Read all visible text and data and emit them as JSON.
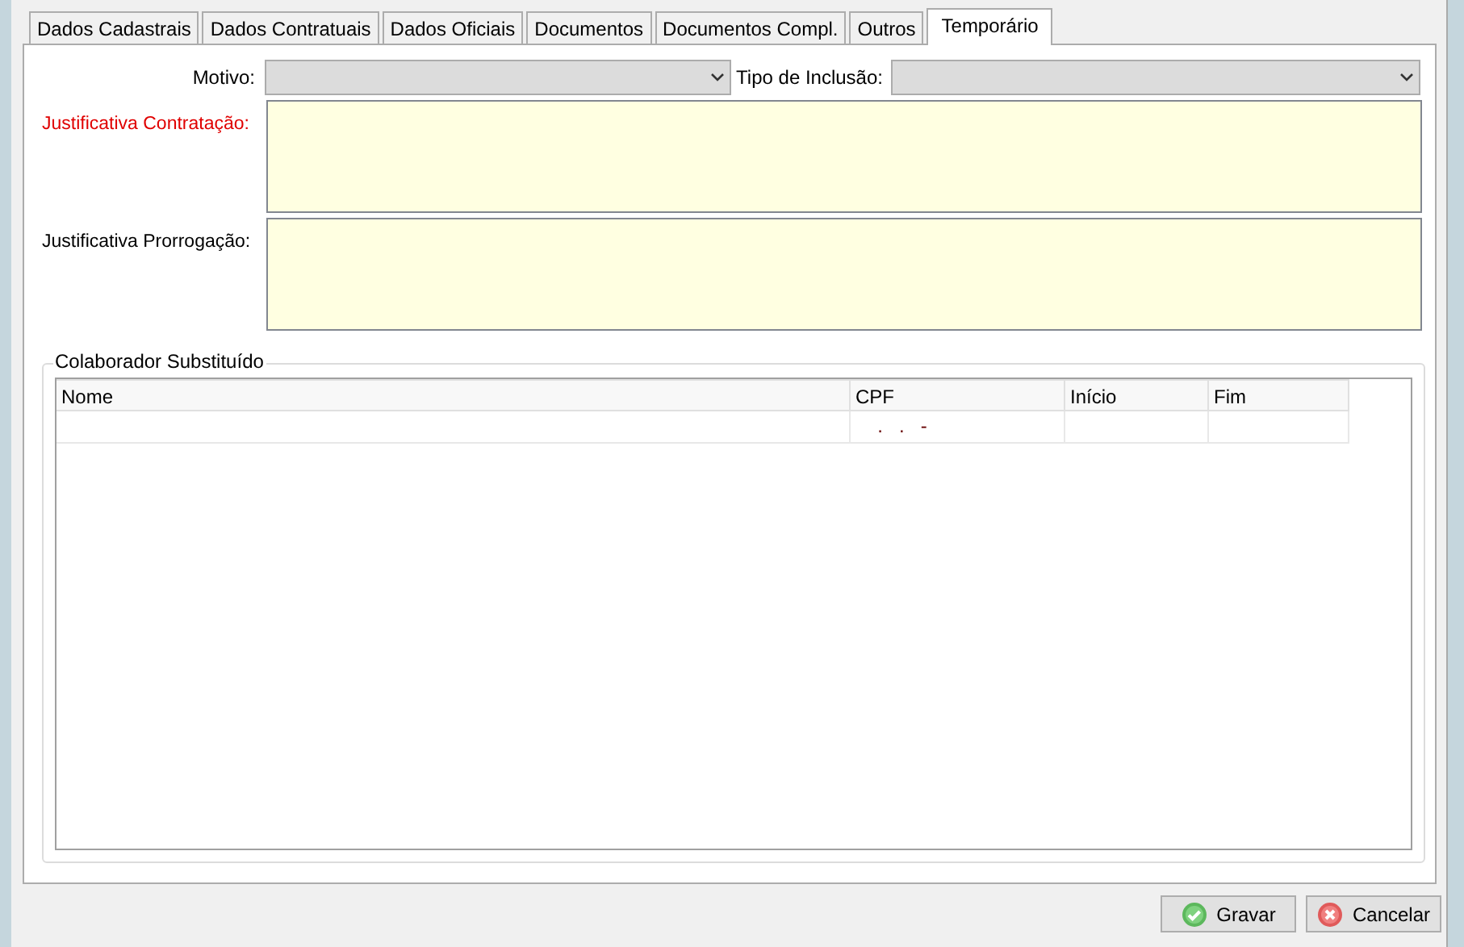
{
  "tabs": [
    {
      "label": "Dados Cadastrais",
      "selected": false
    },
    {
      "label": "Dados Contratuais",
      "selected": false
    },
    {
      "label": "Dados Oficiais",
      "selected": false
    },
    {
      "label": "Documentos",
      "selected": false
    },
    {
      "label": "Documentos Compl.",
      "selected": false
    },
    {
      "label": "Outros",
      "selected": false
    },
    {
      "label": "Temporário",
      "selected": true
    }
  ],
  "form": {
    "motivo": {
      "label": "Motivo:"
    },
    "tipo_inclusao": {
      "label": "Tipo de Inclusão:"
    },
    "justificativas": [
      {
        "label": "Justificativa Contratação:",
        "required": true
      },
      {
        "label": "Justificativa Prorrogação:",
        "required": false
      }
    ]
  },
  "group": {
    "title": "Colaborador Substituído",
    "columns": [
      "Nome",
      "CPF",
      "Início",
      "Fim"
    ],
    "rows": [
      [
        "",
        "  .   .   -",
        "",
        ""
      ]
    ]
  },
  "buttons": [
    {
      "label": "Gravar",
      "kind": "ok"
    },
    {
      "label": "Cancelar",
      "kind": "cancel"
    }
  ]
}
